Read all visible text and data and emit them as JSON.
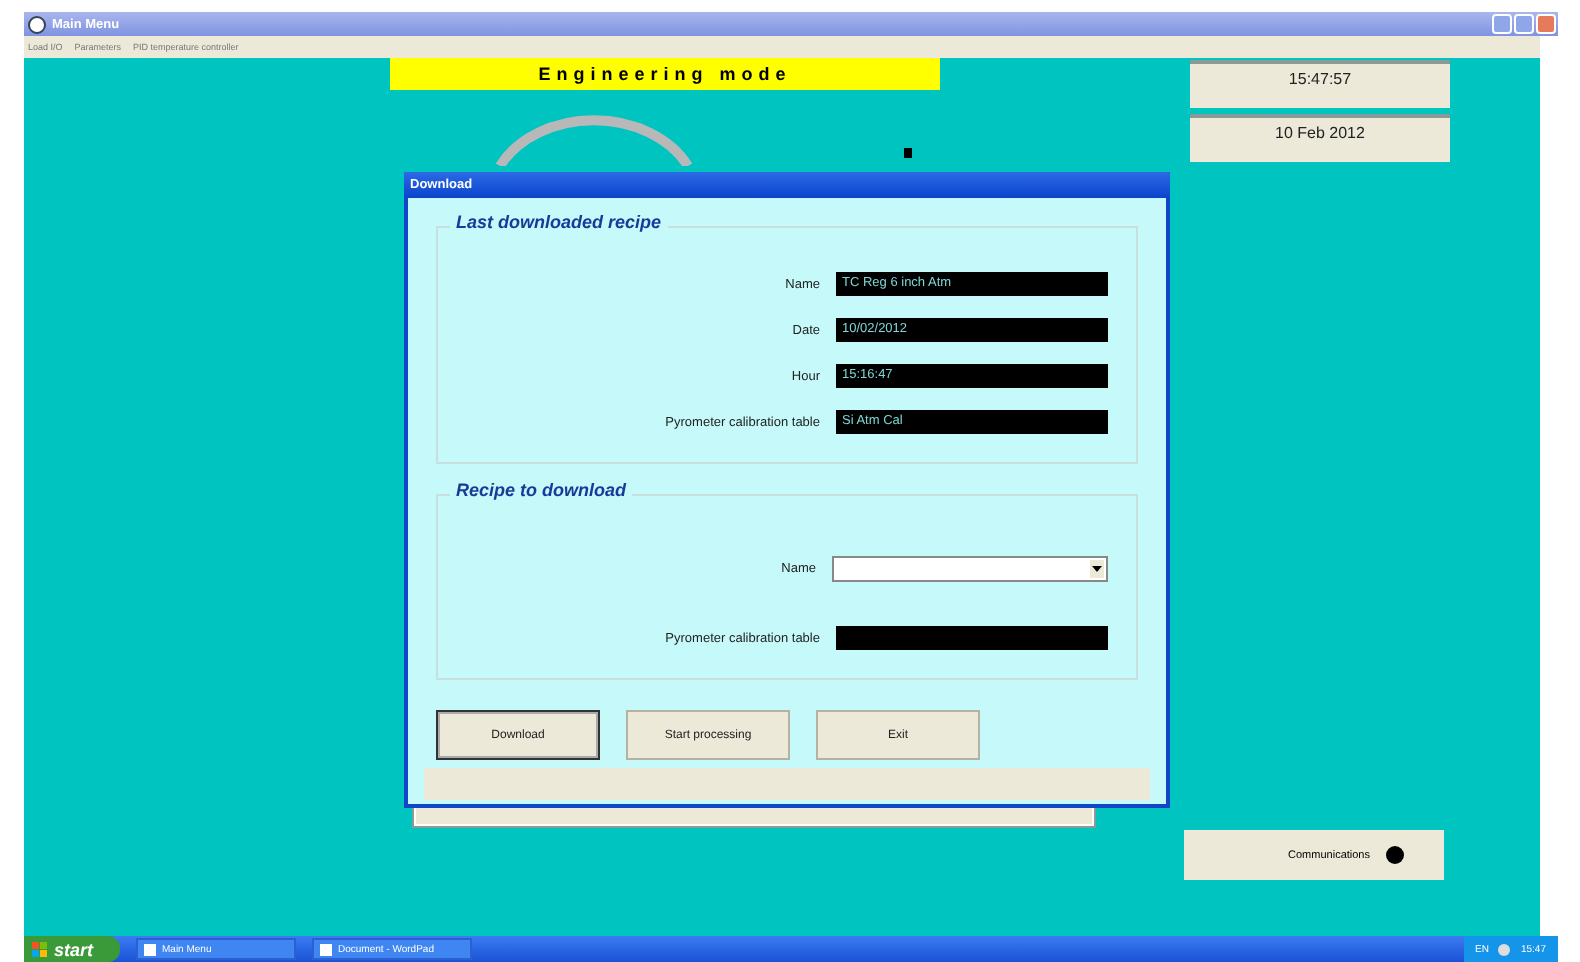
{
  "window": {
    "title": "Main Menu"
  },
  "menu": [
    {
      "label": "Load I/O"
    },
    {
      "label": "Parameters"
    },
    {
      "label": "PID temperature controller"
    }
  ],
  "mode_banner": "Engineering mode",
  "clock": {
    "time": "15:47:57",
    "date": "10 Feb 2012"
  },
  "dialog": {
    "title": "Download",
    "groups": [
      {
        "title": "Last downloaded recipe",
        "fields": [
          {
            "label": "Name",
            "kind": "display",
            "value": "TC Reg 6 inch Atm"
          },
          {
            "label": "Date",
            "kind": "display",
            "value": "10/02/2012"
          },
          {
            "label": "Hour",
            "kind": "display",
            "value": "15:16:47"
          },
          {
            "label": "Pyrometer calibration table",
            "kind": "display",
            "value": "Si Atm Cal"
          }
        ]
      },
      {
        "title": "Recipe to download",
        "fields": [
          {
            "label": "Name",
            "kind": "dropdown"
          },
          {
            "label": "Pyrometer calibration table",
            "kind": "display"
          }
        ]
      }
    ],
    "buttons": [
      {
        "label": "Download",
        "focused": true
      },
      {
        "label": "Start processing",
        "focused": false
      },
      {
        "label": "Exit",
        "focused": false
      }
    ]
  },
  "communications": {
    "label": "Communications"
  },
  "taskbar": {
    "start": "start",
    "tasks": [
      {
        "label": "Main Menu",
        "selected": false
      },
      {
        "label": "Document - WordPad",
        "selected": false
      }
    ],
    "language": "EN",
    "time": "15:47"
  }
}
